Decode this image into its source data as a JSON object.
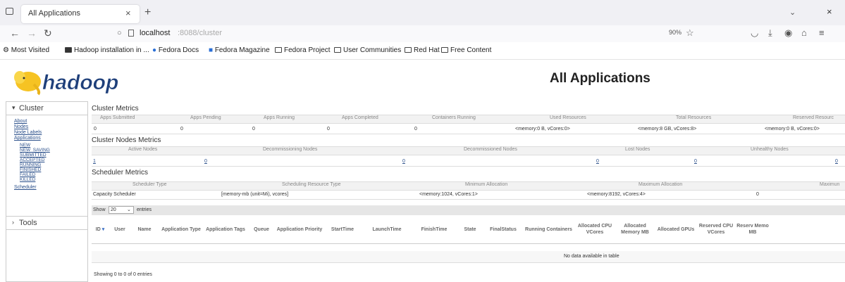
{
  "browser": {
    "tab_title": "All Applications",
    "url_host": "localhost",
    "url_path": ":8088/cluster",
    "zoom": "90%",
    "bookmarks": [
      "Most Visited",
      "Hadoop installation in ...",
      "Fedora Docs",
      "Fedora Magazine",
      "Fedora Project",
      "User Communities",
      "Red Hat",
      "Free Content"
    ]
  },
  "page": {
    "title": "All Applications",
    "logo": "hadoop"
  },
  "sidebar": {
    "cluster_label": "Cluster",
    "links": [
      "About",
      "Nodes",
      "Node Labels",
      "Applications"
    ],
    "app_states": [
      "NEW",
      "NEW_SAVING",
      "SUBMITTED",
      "ACCEPTED",
      "RUNNING",
      "FINISHED",
      "FAILED",
      "KILLED"
    ],
    "scheduler": "Scheduler",
    "tools_label": "Tools"
  },
  "cluster_metrics": {
    "heading": "Cluster Metrics",
    "headers": [
      "Apps Submitted",
      "Apps Pending",
      "Apps Running",
      "Apps Completed",
      "Containers Running",
      "Used Resources",
      "Total Resources",
      "Reserved Resourc"
    ],
    "values": [
      "0",
      "0",
      "0",
      "0",
      "0",
      "<memory:0 B, vCores:0>",
      "<memory:8 GB, vCores:8>",
      "<memory:0 B, vCores:0>"
    ]
  },
  "node_metrics": {
    "heading": "Cluster Nodes Metrics",
    "headers": [
      "Active Nodes",
      "Decommissioning Nodes",
      "Decommissioned Nodes",
      "Lost Nodes",
      "Unhealthy Nodes"
    ],
    "values": [
      "1",
      "0",
      "0",
      "0",
      "0",
      "0"
    ]
  },
  "scheduler_metrics": {
    "heading": "Scheduler Metrics",
    "headers": [
      "Scheduler Type",
      "Scheduling Resource Type",
      "Minimum Allocation",
      "Maximum Allocation",
      "Maximun"
    ],
    "values": [
      "Capacity Scheduler",
      "[memory-mb (unit=Mi), vcores]",
      "<memory:1024, vCores:1>",
      "<memory:8192, vCores:4>",
      "0"
    ]
  },
  "apps_table": {
    "show_label": "Show",
    "page_size": "20",
    "entries_label": "entries",
    "columns": [
      "ID",
      "User",
      "Name",
      "Application Type",
      "Application Tags",
      "Queue",
      "Application Priority",
      "StartTime",
      "LaunchTime",
      "FinishTime",
      "State",
      "FinalStatus",
      "Running Containers",
      "Allocated CPU VCores",
      "Allocated Memory MB",
      "Allocated GPUs",
      "Reserved CPU VCores",
      "Reserv Memo MB"
    ],
    "no_data": "No data available in table",
    "showing": "Showing 0 to 0 of 0 entries"
  }
}
